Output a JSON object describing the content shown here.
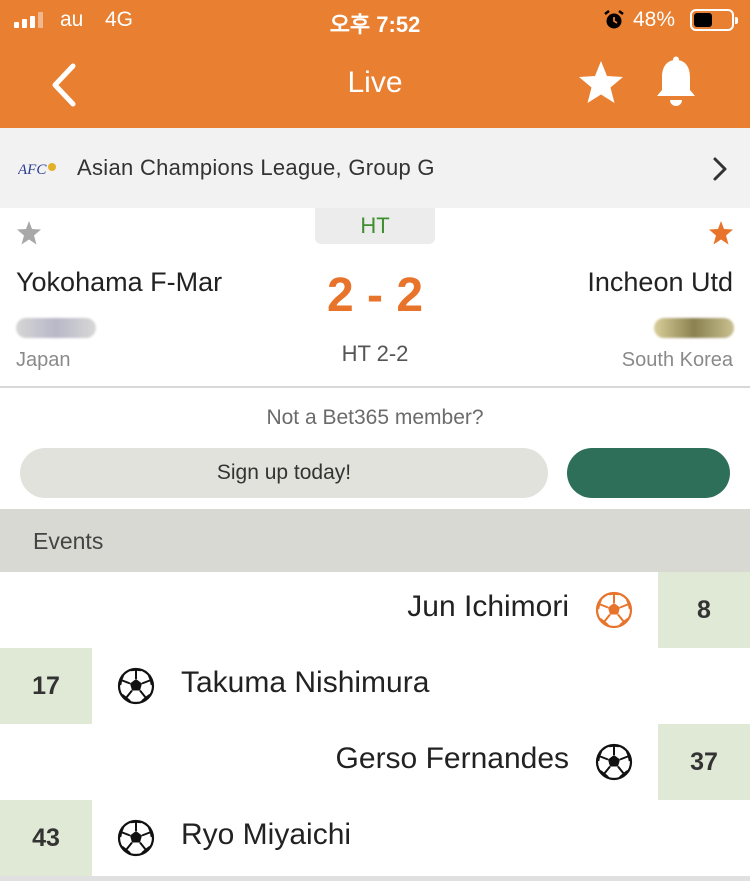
{
  "status_bar": {
    "carrier": "au",
    "network": "4G",
    "time": "오후 7:52",
    "battery": "48%",
    "icons": [
      "signal-icon",
      "alarm-icon",
      "battery-icon"
    ]
  },
  "nav": {
    "title": "Live",
    "icons": [
      "back-chevron-icon",
      "star-icon",
      "bell-icon"
    ]
  },
  "competition": {
    "logo_text": "AFC",
    "name": "Asian Champions League, Group G"
  },
  "match": {
    "status": "HT",
    "home": {
      "name": "Yokohama F-Mar",
      "country": "Japan",
      "favorite": false
    },
    "away": {
      "name": "Incheon Utd",
      "country": "South Korea",
      "favorite": true
    },
    "score": "2 - 2",
    "halftime": "HT 2-2"
  },
  "promo": {
    "question": "Not a Bet365 member?",
    "signup_label": "Sign up today!"
  },
  "events": {
    "header": "Events",
    "items": [
      {
        "side": "away",
        "player": "Jun Ichimori",
        "minute": "8",
        "type": "own-goal"
      },
      {
        "side": "home",
        "player": "Takuma Nishimura",
        "minute": "17",
        "type": "goal"
      },
      {
        "side": "away",
        "player": "Gerso Fernandes",
        "minute": "37",
        "type": "goal"
      },
      {
        "side": "home",
        "player": "Ryo Miyaichi",
        "minute": "43",
        "type": "goal"
      }
    ]
  },
  "colors": {
    "header_orange": "#e87f31",
    "score_orange": "#e8732a",
    "status_green": "#3f8f2f",
    "minute_bg": "#dfe9d6",
    "cta_green": "#2e6f5a"
  }
}
